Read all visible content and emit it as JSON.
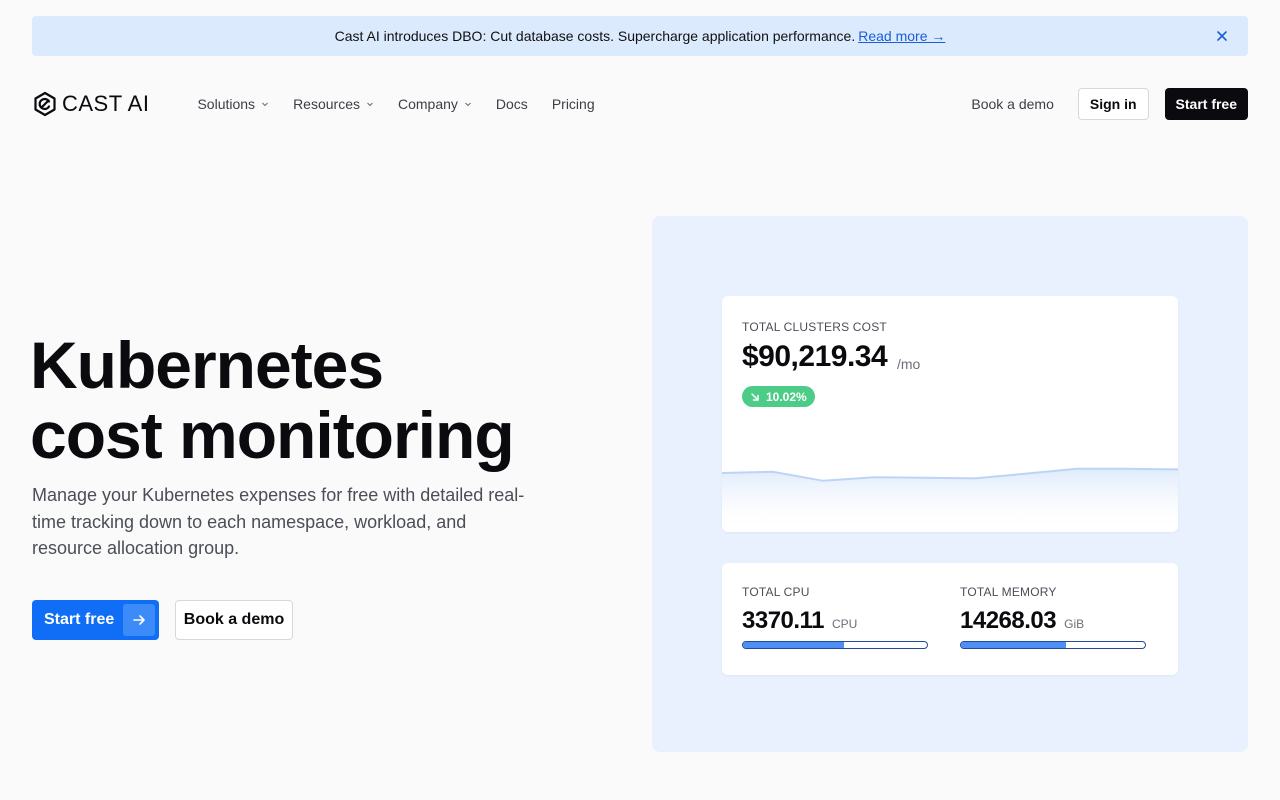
{
  "banner": {
    "text": "Cast AI introduces DBO: Cut database costs. Supercharge application performance.",
    "link": "Read more →"
  },
  "nav": {
    "logo_text": "CAST AI",
    "menu": [
      {
        "label": "Solutions",
        "dropdown": true
      },
      {
        "label": "Resources",
        "dropdown": true
      },
      {
        "label": "Company",
        "dropdown": true
      },
      {
        "label": "Docs",
        "dropdown": false
      },
      {
        "label": "Pricing",
        "dropdown": false
      }
    ],
    "book_demo": "Book a demo",
    "sign_in": "Sign in",
    "start_free": "Start free"
  },
  "hero": {
    "title_line1": "Kubernetes",
    "title_line2": "cost monitoring",
    "subtitle": "Manage your Kubernetes expenses for free with detailed real-time tracking down to each namespace, workload, and resource allocation group.",
    "primary_cta": "Start free",
    "secondary_cta": "Book a demo"
  },
  "dashboard": {
    "cost": {
      "label": "TOTAL CLUSTERS COST",
      "value": "$90,219.34",
      "unit": "/mo",
      "change": "10.02%",
      "trend": [
        0.55,
        0.57,
        0.42,
        0.48,
        0.47,
        0.46,
        0.54,
        0.62,
        0.62,
        0.61
      ]
    },
    "cpu": {
      "label": "TOTAL CPU",
      "value": "3370.11",
      "unit": "CPU",
      "fill_fraction": 0.55
    },
    "memory": {
      "label": "TOTAL MEMORY",
      "value": "14268.03",
      "unit": "GiB",
      "fill_fraction": 0.57
    }
  },
  "colors": {
    "accent": "#0f6ef5",
    "banner_bg": "#dbeafd",
    "panel_bg": "#e8f1fd",
    "badge_green": "#4ccc86"
  }
}
